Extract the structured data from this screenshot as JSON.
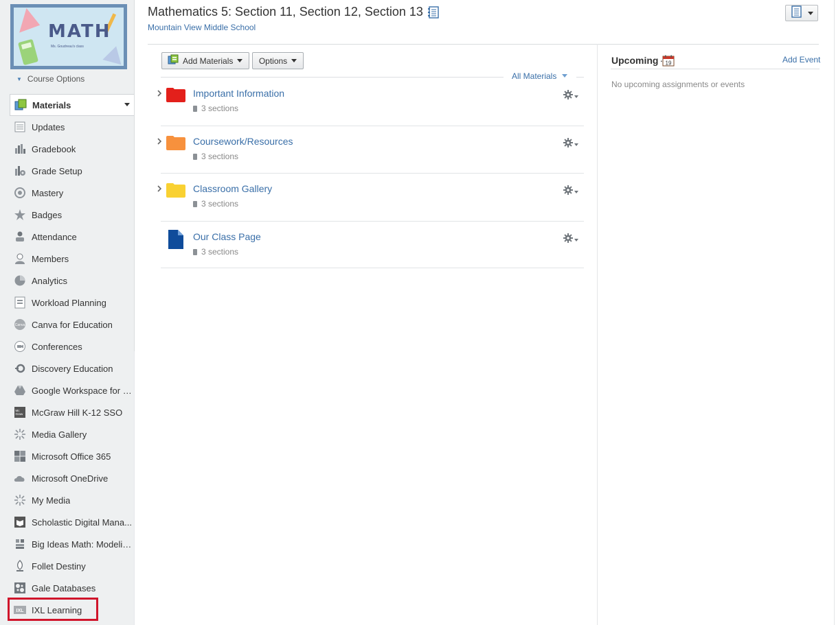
{
  "course": {
    "title": "Mathematics 5: Section 11, Section 12, Section 13",
    "school": "Mountain View Middle School",
    "banner_text": "MATH",
    "banner_subtext": "Ms. Goudreau's class"
  },
  "sidebar": {
    "course_options_label": "Course Options",
    "items": [
      {
        "label": "Materials",
        "icon": "materials-icon"
      },
      {
        "label": "Updates",
        "icon": "updates-icon"
      },
      {
        "label": "Gradebook",
        "icon": "gradebook-icon"
      },
      {
        "label": "Grade Setup",
        "icon": "grade-setup-icon"
      },
      {
        "label": "Mastery",
        "icon": "mastery-icon"
      },
      {
        "label": "Badges",
        "icon": "badges-icon"
      },
      {
        "label": "Attendance",
        "icon": "attendance-icon"
      },
      {
        "label": "Members",
        "icon": "members-icon"
      },
      {
        "label": "Analytics",
        "icon": "analytics-icon"
      },
      {
        "label": "Workload Planning",
        "icon": "workload-planning-icon"
      },
      {
        "label": "Canva for Education",
        "icon": "canva-icon"
      },
      {
        "label": "Conferences",
        "icon": "conferences-icon"
      },
      {
        "label": "Discovery Education",
        "icon": "discovery-education-icon"
      },
      {
        "label": "Google Workspace for E...",
        "icon": "google-drive-icon"
      },
      {
        "label": "McGraw Hill K-12 SSO",
        "icon": "mcgraw-hill-icon"
      },
      {
        "label": "Media Gallery",
        "icon": "media-gallery-icon"
      },
      {
        "label": "Microsoft Office 365",
        "icon": "microsoft-office-icon"
      },
      {
        "label": "Microsoft OneDrive",
        "icon": "onedrive-icon"
      },
      {
        "label": "My Media",
        "icon": "my-media-icon"
      },
      {
        "label": "Scholastic Digital Mana...",
        "icon": "scholastic-icon"
      },
      {
        "label": "Big Ideas Math: Modelin...",
        "icon": "big-ideas-math-icon"
      },
      {
        "label": "Follet Destiny",
        "icon": "follett-destiny-icon"
      },
      {
        "label": "Gale Databases",
        "icon": "gale-databases-icon"
      },
      {
        "label": "IXL Learning",
        "icon": "ixl-icon"
      }
    ]
  },
  "toolbar": {
    "add_materials_label": "Add Materials",
    "options_label": "Options",
    "filter_label": "All Materials"
  },
  "materials": [
    {
      "title": "Important Information",
      "meta": "3 sections",
      "icon": "folder-icon",
      "color": "#e3201b"
    },
    {
      "title": "Coursework/Resources",
      "meta": "3 sections",
      "icon": "folder-icon",
      "color": "#f7913d"
    },
    {
      "title": "Classroom Gallery",
      "meta": "3 sections",
      "icon": "folder-icon",
      "color": "#f9d132"
    },
    {
      "title": "Our Class Page",
      "meta": "3 sections",
      "icon": "page-icon",
      "color": "#0f4c9b"
    }
  ],
  "upcoming": {
    "title": "Upcoming",
    "calendar_day": "19",
    "add_event_label": "Add Event",
    "empty_text": "No upcoming assignments or events"
  },
  "colors": {
    "link": "#3a6fa8",
    "highlight": "#d0152b"
  }
}
